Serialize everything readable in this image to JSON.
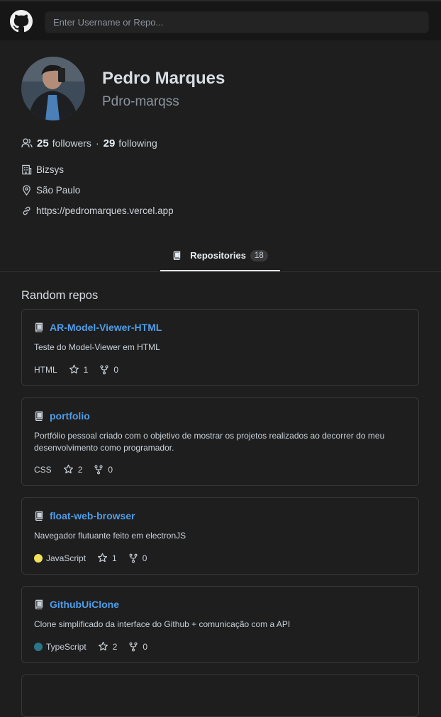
{
  "search": {
    "placeholder": "Enter Username or Repo..."
  },
  "profile": {
    "name": "Pedro Marques",
    "login": "Pdro-marqss",
    "followers_count": "25",
    "followers_label": "followers",
    "following_count": "29",
    "following_label": "following",
    "company": "Bizsys",
    "location": "São Paulo",
    "blog": "https://pedromarques.vercel.app",
    "separator": "·"
  },
  "tabs": [
    {
      "label": "Repositories",
      "count": "18"
    }
  ],
  "section": {
    "title": "Random repos"
  },
  "repos": [
    {
      "name": "AR-Model-Viewer-HTML",
      "description": "Teste do Model-Viewer em HTML",
      "language": "HTML",
      "language_color": null,
      "stars": "1",
      "forks": "0"
    },
    {
      "name": "portfolio",
      "description": "Portfólio pessoal criado com o objetivo de mostrar os projetos realizados ao decorrer do meu desenvolvimento como programador.",
      "language": "CSS",
      "language_color": null,
      "stars": "2",
      "forks": "0"
    },
    {
      "name": "float-web-browser",
      "description": "Navegador flutuante feito em electronJS",
      "language": "JavaScript",
      "language_color": "#f1e05a",
      "stars": "1",
      "forks": "0"
    },
    {
      "name": "GithubUiClone",
      "description": "Clone simplificado da interface do Github + comunicação com a API",
      "language": "TypeScript",
      "language_color": "#2b7489",
      "stars": "2",
      "forks": "0"
    }
  ],
  "icons": {
    "logo": "github-logo-icon",
    "followers": "people-icon",
    "company": "organization-icon",
    "location": "location-pin-icon",
    "blog": "link-icon",
    "repo": "repo-book-icon",
    "star": "star-icon",
    "fork": "fork-icon"
  },
  "colors": {
    "background": "#1e1e1e",
    "header": "#161616",
    "link": "#4f9dea"
  }
}
